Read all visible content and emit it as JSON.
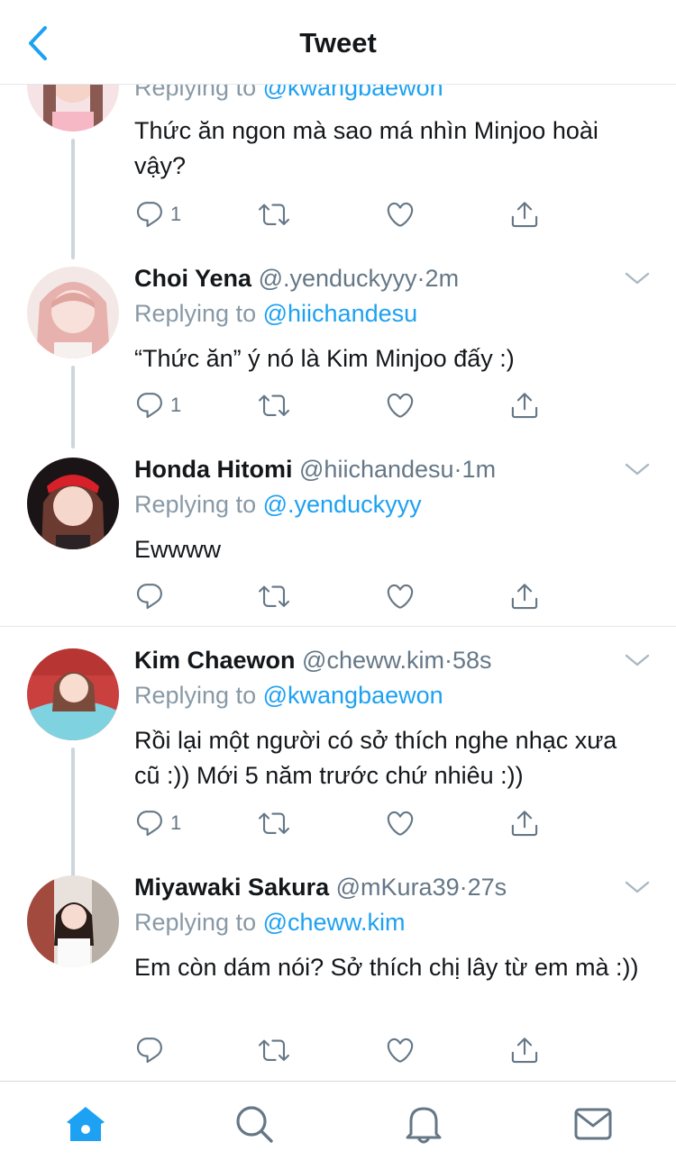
{
  "header": {
    "title": "Tweet"
  },
  "colors": {
    "accent": "#1da1f2",
    "text": "#14171a",
    "muted": "#657786",
    "line": "#ccd6dd"
  },
  "tweets": [
    {
      "reply_prefix": "Replying to",
      "reply_to": "@kwangbaewon",
      "text": "Thức ăn ngon mà sao má nhìn Minjoo hoài vậy?",
      "reply_count": "1"
    },
    {
      "name": "Choi Yena",
      "handle": "@.yenduckyyy",
      "dot": "·",
      "time": "2m",
      "reply_prefix": "Replying to",
      "reply_to": "@hiichandesu",
      "text": "“Thức ăn” ý nó là Kim Minjoo đấy :)",
      "reply_count": "1"
    },
    {
      "name": "Honda Hitomi",
      "handle": "@hiichandesu",
      "dot": "·",
      "time": "1m",
      "reply_prefix": "Replying to",
      "reply_to": "@.yenduckyyy",
      "text": "Ewwww",
      "reply_count": ""
    },
    {
      "name": "Kim Chaewon",
      "handle": "@cheww.kim",
      "dot": "·",
      "time": "58s",
      "reply_prefix": "Replying to",
      "reply_to": "@kwangbaewon",
      "text": "Rồi lại một người có sở thích nghe nhạc xưa cũ :)) Mới 5 năm trước chứ nhiêu :))",
      "reply_count": "1"
    },
    {
      "name": "Miyawaki Sakura",
      "handle": "@mKura39",
      "dot": "·",
      "time": "27s",
      "reply_prefix": "Replying to",
      "reply_to": "@cheww.kim",
      "text": "Em còn dám nói? Sở thích chị lây từ em mà :))",
      "reply_count": ""
    }
  ],
  "tabbar": {
    "items": [
      {
        "icon": "home-icon",
        "active": true
      },
      {
        "icon": "search-icon",
        "active": false
      },
      {
        "icon": "bell-icon",
        "active": false
      },
      {
        "icon": "mail-icon",
        "active": false
      }
    ]
  }
}
